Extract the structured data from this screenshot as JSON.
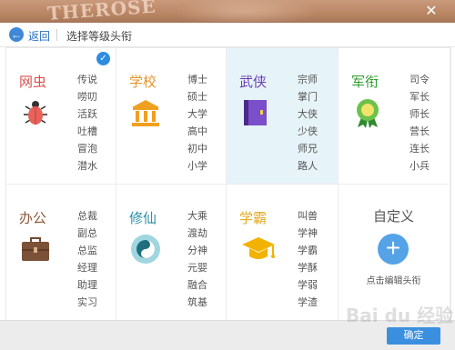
{
  "header": {
    "banner_text": "THEROSE",
    "close_label": "✕"
  },
  "nav": {
    "back_label": "返回",
    "title": "选择等级头衔"
  },
  "colors": {
    "accent": "#3b8fdf",
    "selected_bg": "#e6f3f8"
  },
  "categories": [
    {
      "name": "网虫",
      "color": "#d9534f",
      "icon": "bug-icon",
      "items": [
        "传说",
        "唠叨",
        "活跃",
        "吐槽",
        "冒泡",
        "潜水"
      ],
      "selected": false,
      "checked": true
    },
    {
      "name": "学校",
      "color": "#e6952a",
      "icon": "school-building-icon",
      "items": [
        "博士",
        "硕士",
        "大学",
        "高中",
        "初中",
        "小学"
      ],
      "selected": false,
      "checked": false
    },
    {
      "name": "武侠",
      "color": "#6a3fb2",
      "icon": "martial-book-icon",
      "items": [
        "宗师",
        "掌门",
        "大侠",
        "少侠",
        "师兄",
        "路人"
      ],
      "selected": true,
      "checked": false
    },
    {
      "name": "军衔",
      "color": "#2f9e2f",
      "icon": "medal-icon",
      "items": [
        "司令",
        "军长",
        "师长",
        "营长",
        "连长",
        "小兵"
      ],
      "selected": false,
      "checked": false
    },
    {
      "name": "办公",
      "color": "#8b5a3c",
      "icon": "briefcase-icon",
      "items": [
        "总裁",
        "副总",
        "总监",
        "经理",
        "助理",
        "实习"
      ],
      "selected": false,
      "checked": false
    },
    {
      "name": "修仙",
      "color": "#2a8fa8",
      "icon": "yin-yang-icon",
      "items": [
        "大乘",
        "渡劫",
        "分神",
        "元婴",
        "融合",
        "筑基"
      ],
      "selected": false,
      "checked": false
    },
    {
      "name": "学霸",
      "color": "#e6a81e",
      "icon": "graduation-cap-icon",
      "items": [
        "叫兽",
        "学神",
        "学霸",
        "学酥",
        "学弱",
        "学渣"
      ],
      "selected": false,
      "checked": false
    }
  ],
  "custom": {
    "title": "自定义",
    "caption": "点击编辑头衔"
  },
  "footer": {
    "confirm_label": "确定"
  },
  "watermark": "Bai du 经验"
}
